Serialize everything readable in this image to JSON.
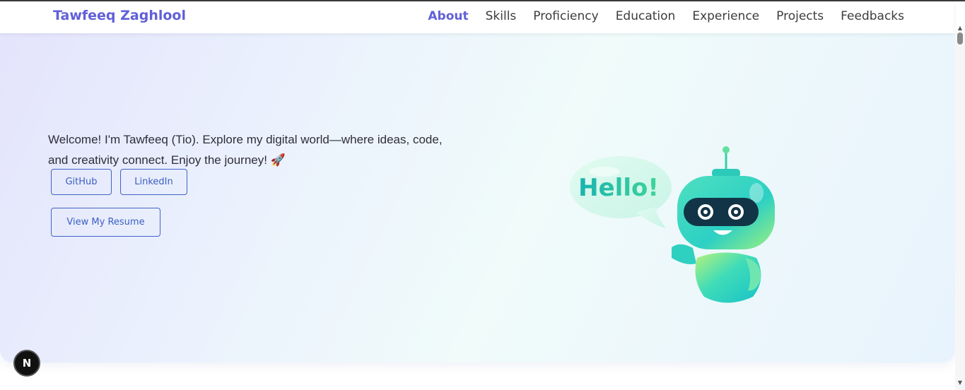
{
  "header": {
    "brand": "Tawfeeq Zaghlool",
    "nav": [
      {
        "label": "About",
        "active": true
      },
      {
        "label": "Skills",
        "active": false
      },
      {
        "label": "Proficiency",
        "active": false
      },
      {
        "label": "Education",
        "active": false
      },
      {
        "label": "Experience",
        "active": false
      },
      {
        "label": "Projects",
        "active": false
      },
      {
        "label": "Feedbacks",
        "active": false
      }
    ]
  },
  "hero": {
    "welcome_text": "Welcome! I'm Tawfeeq (Tio). Explore my digital world—where ideas, code, and creativity connect. Enjoy the journey! 🚀",
    "github_label": "GitHub",
    "linkedin_label": "LinkedIn",
    "resume_label": "View My Resume",
    "bubble_text": "Hello!"
  },
  "badge": {
    "letter": "N"
  },
  "colors": {
    "brand": "#6160d8",
    "button_border": "#3f63c8",
    "robot_teal": "#2ad3c3"
  },
  "icons": {
    "robot": "robot-mascot-icon",
    "speech_bubble": "speech-bubble-icon"
  }
}
